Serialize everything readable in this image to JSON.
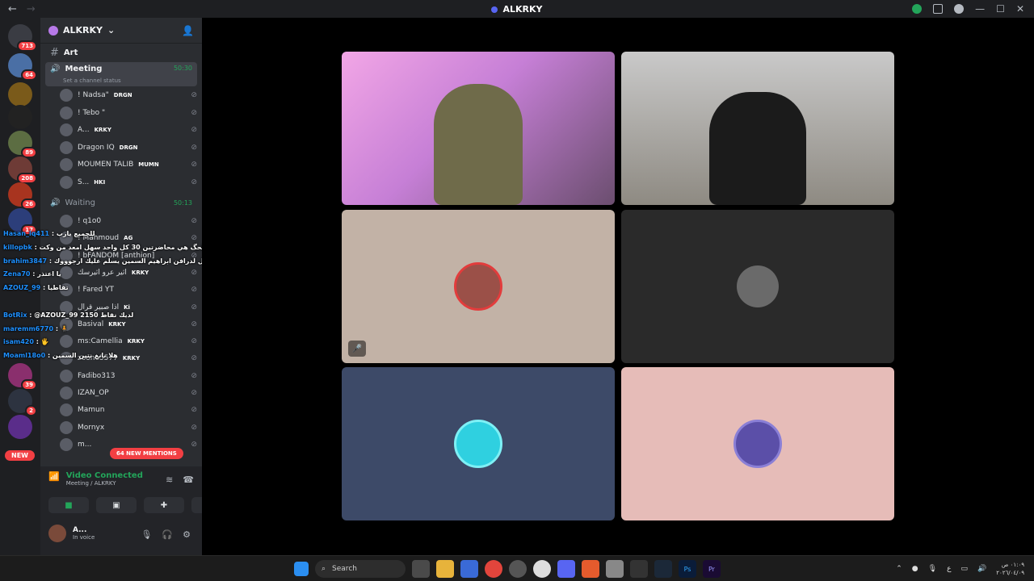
{
  "window": {
    "title": "ALKRKY"
  },
  "guilds": {
    "badges": [
      "713",
      "64",
      "89",
      "208",
      "26",
      "17",
      "39",
      "2"
    ],
    "new_label": "NEW"
  },
  "server": {
    "name": "ALKRKY"
  },
  "channels": {
    "art": "Art",
    "meeting": {
      "name": "Meeting",
      "time": "50:30",
      "status": "Set a channel status"
    },
    "waiting": {
      "name": "Waiting",
      "time": "50:13"
    }
  },
  "meeting_members": [
    {
      "name": "! Nadsa\"",
      "tag": "DRGN"
    },
    {
      "name": "! Tebo \"",
      "tag": ""
    },
    {
      "name": "A...",
      "tag": "KRKY"
    },
    {
      "name": "Dragon IQ",
      "tag": "DRGN"
    },
    {
      "name": "MOUMEN TALIB",
      "tag": "MUMN"
    },
    {
      "name": "S...",
      "tag": "HKI"
    }
  ],
  "waiting_members": [
    {
      "name": "! q1o0",
      "tag": ""
    },
    {
      "name": "! Mahmoud",
      "tag": "AG"
    },
    {
      "name": "! bFANDOM [anthion]",
      "tag": ""
    },
    {
      "name": "اثير عرو اثيرسك",
      "tag": "KRKY"
    },
    {
      "name": "! Fared YT",
      "tag": ""
    },
    {
      "name": "اذا صبير قرال",
      "tag": "Ki"
    },
    {
      "name": "Basival",
      "tag": "KRKY"
    },
    {
      "name": "ms:Camellia",
      "tag": "KRKY"
    },
    {
      "name": "zoono5577",
      "tag": "KRKY"
    },
    {
      "name": "Fadibo313",
      "tag": ""
    },
    {
      "name": "IZAN_OP",
      "tag": ""
    },
    {
      "name": "Mamun",
      "tag": ""
    },
    {
      "name": "Mornyx",
      "tag": ""
    },
    {
      "name": "m...",
      "tag": ""
    }
  ],
  "mentions": "64 NEW MENTIONS",
  "chat_overlay": [
    {
      "user": "Hasan_iq411",
      "text": ": للجميع يارب"
    },
    {
      "user": "killopbk",
      "text": ": الشاشة دوامي عصري والحگ هي محاضرتين 30 كل واحد سهل امعد من وكت"
    },
    {
      "user": "brahim3847",
      "text": ": ادخل عندهم ارجوك وقول لدرافن ابراهيم السمين يسلم عليك ارجوووك"
    },
    {
      "user": "Zena70",
      "text": ": يا اعتذر"
    },
    {
      "user": "AZOUZ_99",
      "text": ": تفاطيا"
    },
    {
      "user": "",
      "text": ""
    },
    {
      "user": "BotRix",
      "text": ": @AZOUZ_99 لديك نقاط 2150"
    },
    {
      "user": "maremm6770",
      "text": ": 🧍"
    },
    {
      "user": "isam420",
      "text": ": 🖐"
    },
    {
      "user": "Moaml18o0",
      "text": ": هلا بابغ نتين السمين"
    }
  ],
  "voice_panel": {
    "title": "Video Connected",
    "subtitle": "Meeting / ALKRKY"
  },
  "user": {
    "name": "A...",
    "status": "In voice"
  },
  "taskbar": {
    "search": "Search",
    "time": "٠١:٠٩ ص",
    "date": "٢٠٢٦/٠٤/٠٩",
    "lang": "ع"
  },
  "colors": {
    "accent": "#5865f2",
    "online": "#23a55a",
    "badge": "#f23f43",
    "tile_beige": "#c2b2a6",
    "tile_dark": "#2a2a2a",
    "tile_navy": "#3d4a68",
    "tile_pink": "#e6bcb8"
  }
}
